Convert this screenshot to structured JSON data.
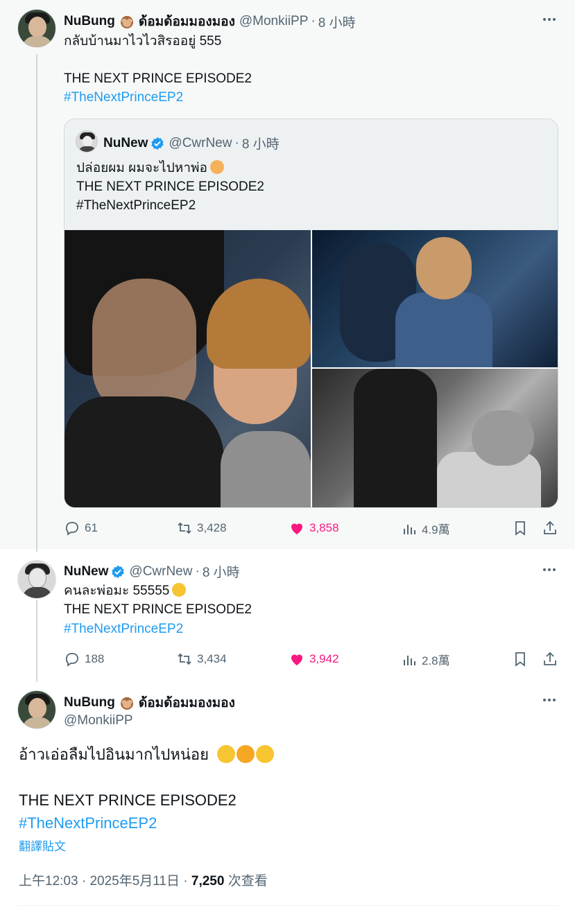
{
  "tweet1": {
    "name": "NuBung",
    "name_suffix": "ด้อมด้อมมองมอง",
    "handle": "@MonkiiPP",
    "dot": "·",
    "time": "8 小時",
    "text_line1": "กลับบ้านมาไวไวสิรออยู่ 555",
    "text_line2": "THE NEXT PRINCE EPISODE2",
    "hashtag": "#TheNextPrinceEP2",
    "quote": {
      "name": "NuNew",
      "handle": "@CwrNew",
      "dot": "·",
      "time": "8 小時",
      "line1": "ปล่อยผม ผมจะไปหาพ่อ",
      "line2": "THE NEXT PRINCE EPISODE2",
      "line3": "#TheNextPrinceEP2"
    },
    "stats": {
      "replies": "61",
      "retweets": "3,428",
      "likes": "3,858",
      "views": "4.9萬"
    }
  },
  "tweet2": {
    "name": "NuNew",
    "handle": "@CwrNew",
    "dot": "·",
    "time": "8 小時",
    "text_line1": "คนละพ่อมะ 55555",
    "text_line2": "THE NEXT PRINCE EPISODE2",
    "hashtag": "#TheNextPrinceEP2",
    "stats": {
      "replies": "188",
      "retweets": "3,434",
      "likes": "3,942",
      "views": "2.8萬"
    }
  },
  "main": {
    "name": "NuBung",
    "name_suffix": "ด้อมด้อมมองมอง",
    "handle": "@MonkiiPP",
    "text_line1": "อ้าวเอ่อลืมไปอินมากไปหน่อย",
    "text_line2": "THE NEXT PRINCE EPISODE2",
    "hashtag": "#TheNextPrinceEP2",
    "translate": "翻譯貼文",
    "time": "上午12:03",
    "sep": "·",
    "date": "2025年5月11日",
    "views_count": "7,250",
    "views_label": "次查看"
  },
  "icons": [
    "more-icon",
    "verified-icon",
    "reply-icon",
    "retweet-icon",
    "like-icon",
    "views-icon",
    "bookmark-icon",
    "share-icon",
    "monkey-emoji-icon",
    "crying-emoji-icon",
    "tears-of-joy-emoji-icon",
    "rofl-emoji-icon",
    "sweat-smile-emoji-icon"
  ],
  "colors": {
    "link": "#1d9bf0",
    "like": "#f91880",
    "secondary": "#536471",
    "verified": "#1d9bf0"
  }
}
